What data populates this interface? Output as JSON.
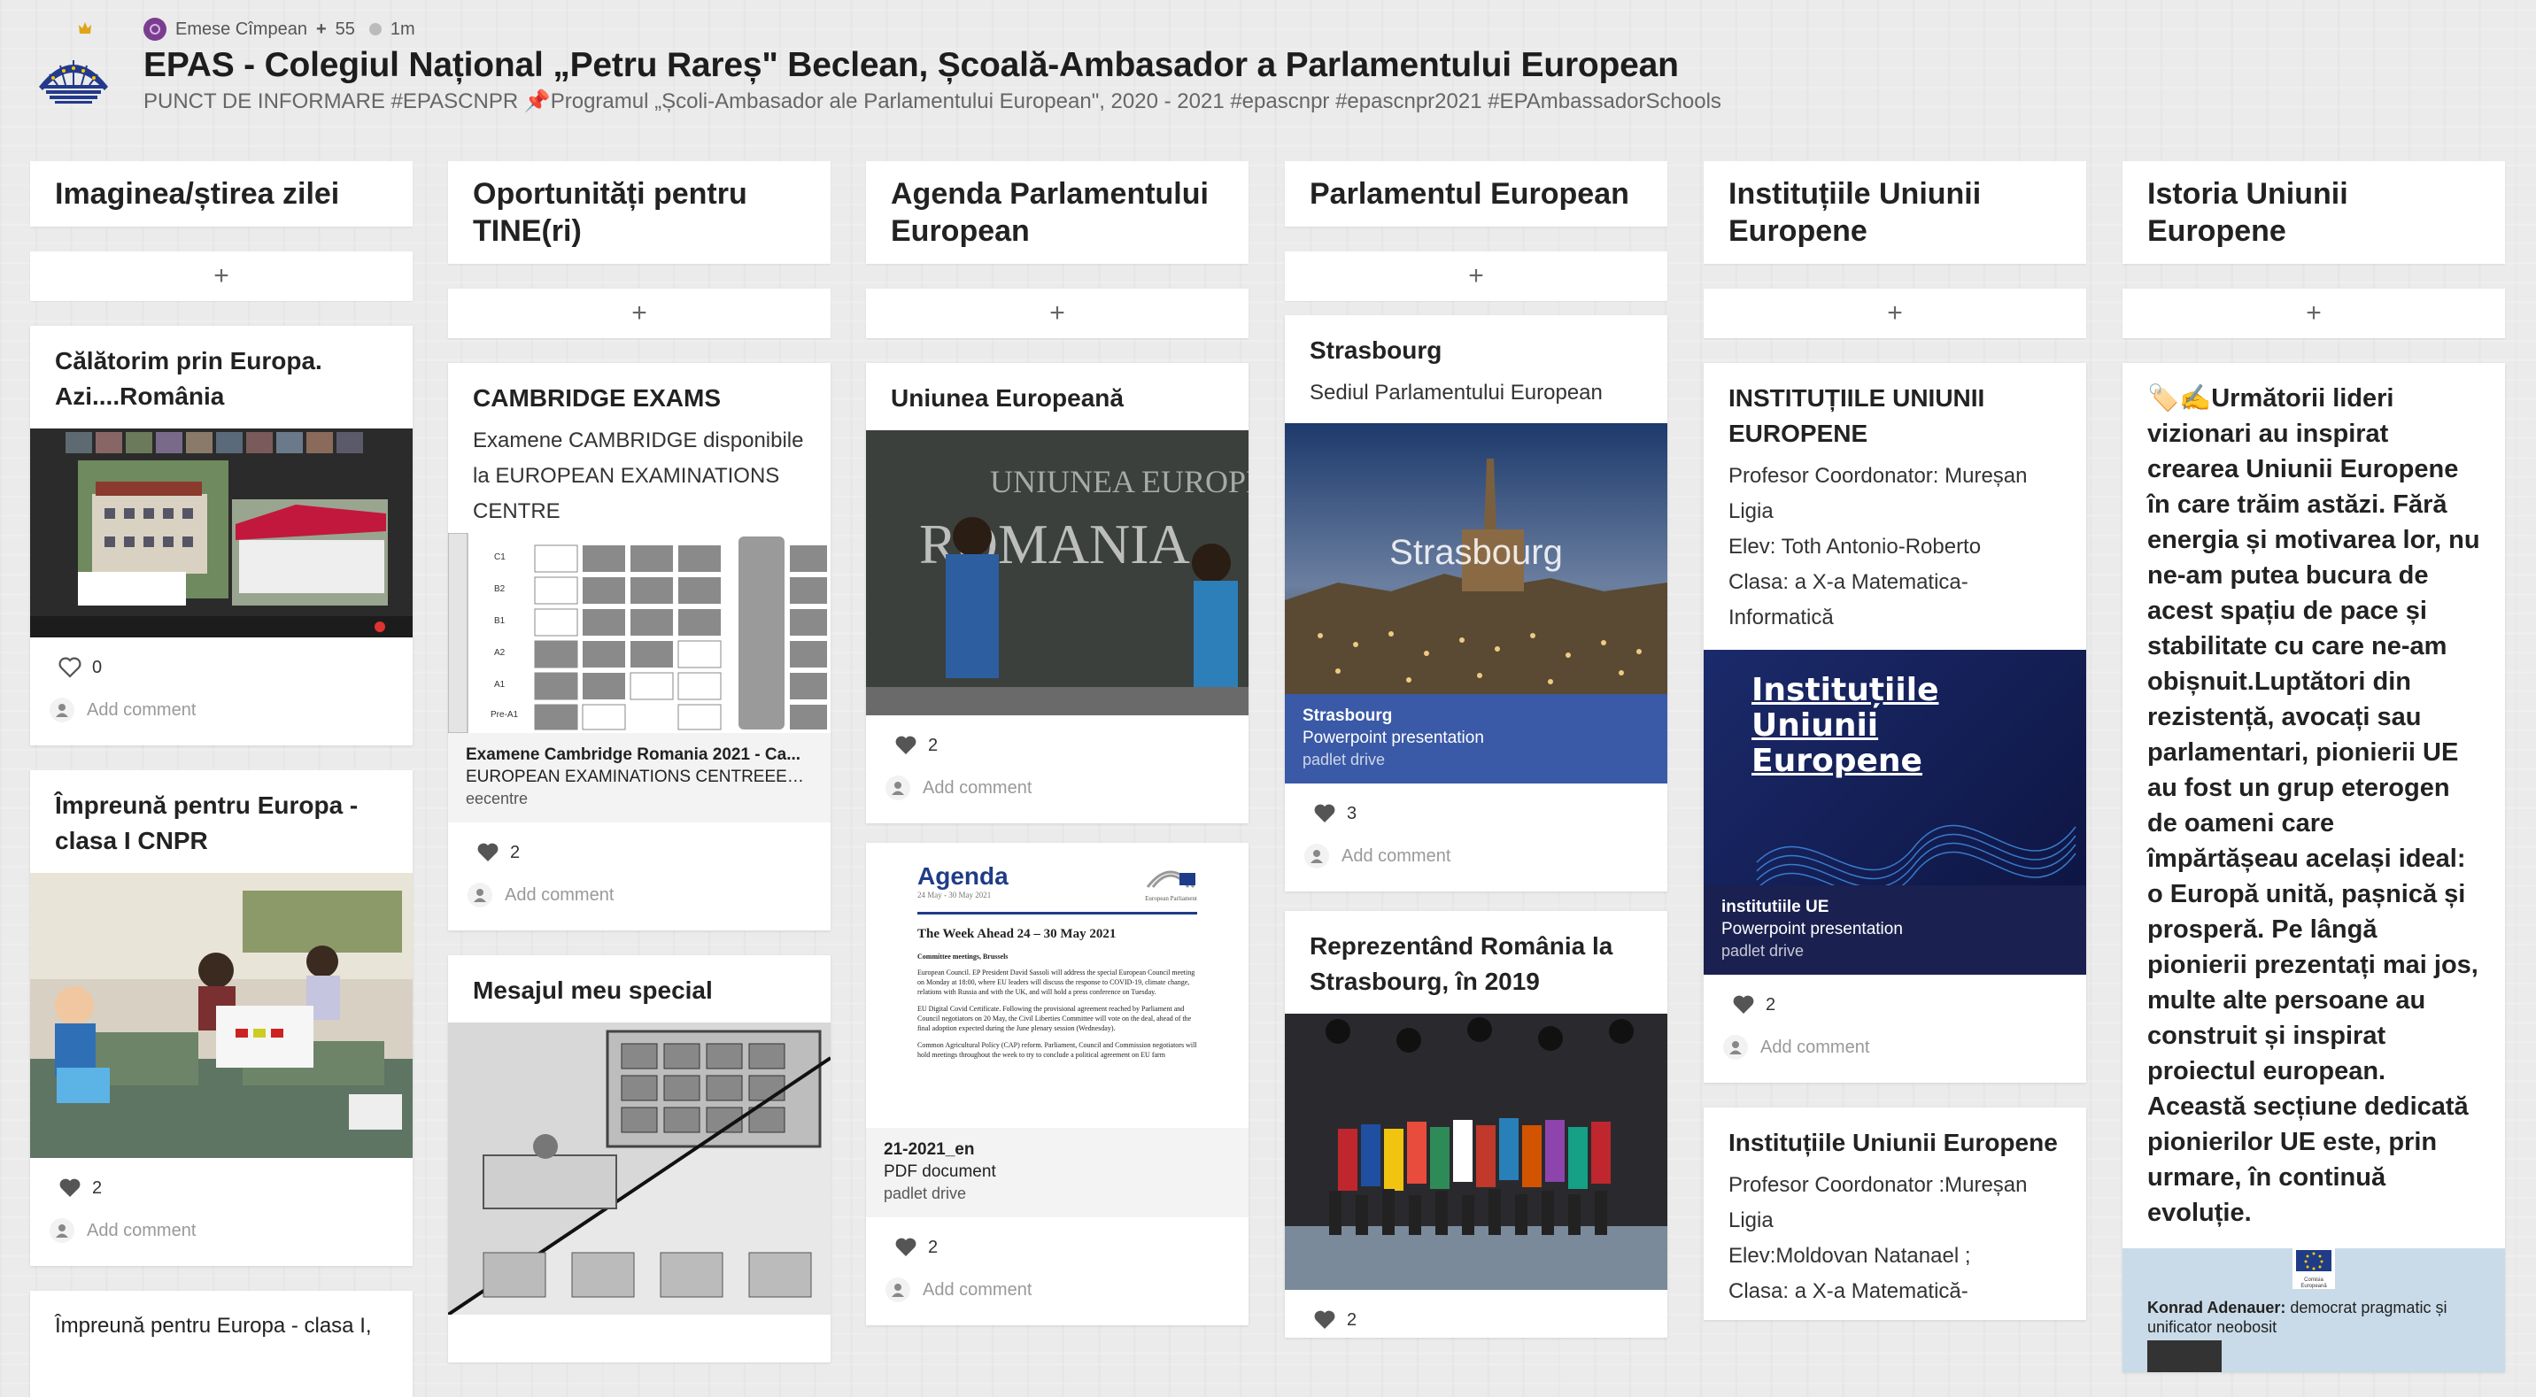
{
  "header": {
    "author": "Emese Cîmpean",
    "plus_count": "55",
    "time_ago": "1m",
    "title": "EPAS - Colegiul Național „Petru Rareș\" Beclean, Școală-Ambasador a Parlamentului European",
    "subtitle": "PUNCT DE INFORMARE #EPASCNPR 📌Programul „Școli-Ambasador ale Parlamentului European\", 2020 - 2021 #epascnpr #epascnpr2021 #EPAmbassadorSchools"
  },
  "common": {
    "add": "+",
    "add_comment": "Add comment"
  },
  "columns": [
    {
      "title": "Imaginea/știrea zilei",
      "cards": [
        {
          "title": "Călătorim prin Europa. Azi....România",
          "likes": "0"
        },
        {
          "title": "Împreună pentru Europa - clasa I CNPR",
          "likes": "2"
        },
        {
          "title": "Împreună pentru Europa - clasa I,"
        }
      ]
    },
    {
      "title": "Oportunități pentru TINE(ri)",
      "cards": [
        {
          "title": "CAMBRIDGE EXAMS",
          "body": "Examene CAMBRIDGE disponibile la EUROPEAN EXAMINATIONS CENTRE",
          "att_title": "Examene Cambridge Romania 2021 - Ca...",
          "att_sub": "EUROPEAN EXAMINATIONS CENTREEEC...",
          "att_src": "eecentre",
          "likes": "2"
        },
        {
          "title": "Mesajul meu special"
        }
      ]
    },
    {
      "title": "Agenda Parlamentului European",
      "cards": [
        {
          "title": "Uniunea Europeană",
          "likes": "2"
        },
        {
          "att_title": "21-2021_en",
          "att_sub": "PDF document",
          "att_src": "padlet drive",
          "likes": "2"
        }
      ],
      "agenda_doc": {
        "heading": "Agenda",
        "dates": "24 May - 30 May 2021",
        "ep": "European Parliament",
        "week": "The Week Ahead 24 – 30 May 2021",
        "section": "Committee meetings, Brussels",
        "p1": "European Council. EP President David Sassoli will address the special European Council meeting on Monday at 18:00, where EU leaders will discuss the response to COVID-19, climate change, relations with Russia and with the UK, and will hold a press conference on Tuesday.",
        "p2": "EU Digital Covid Certificate. Following the provisional agreement reached by Parliament and Council negotiators on 20 May, the Civil Liberties Committee will vote on the deal, ahead of the final adoption expected during the June plenary session (Wednesday).",
        "p3": "Common Agricultural Policy (CAP) reform. Parliament, Council and Commission negotiators will hold meetings throughout the week to try to conclude a political agreement on EU farm"
      }
    },
    {
      "title": "Parlamentul European",
      "cards": [
        {
          "title": "Strasbourg",
          "body": "Sediul Parlamentului European",
          "img_label": "Strasbourg",
          "att_title": "Strasbourg",
          "att_sub": "Powerpoint presentation",
          "att_src": "padlet drive",
          "likes": "3"
        },
        {
          "title": "Reprezentând România la Strasbourg, în 2019",
          "likes": "2"
        }
      ]
    },
    {
      "title": "Instituțiile Uniunii Europene",
      "cards": [
        {
          "title": "INSTITUȚIILE UNIUNII EUROPENE",
          "body": "Profesor Coordonator: Mureșan Ligia\nElev: Toth Antonio-Roberto\nClasa: a X-a Matematica-Informatică",
          "slide_title": "Instituțiile Uniunii Europene",
          "att_title": "institutiile UE",
          "att_sub": "Powerpoint presentation",
          "att_src": "padlet drive",
          "likes": "2"
        },
        {
          "title": "Instituțiile Uniunii Europene",
          "body": "Profesor Coordonator :Mureșan Ligia\nElev:Moldovan Natanael ;\nClasa: a X-a Matematică-"
        }
      ]
    },
    {
      "title": "Istoria Uniunii Europene",
      "cards": [
        {
          "body": "🏷️✍️Următorii lideri vizionari au inspirat crearea Uniunii Europene în care trăim astăzi. Fără energia și motivarea lor, nu ne-am putea bucura de acest spațiu de pace și stabilitate cu care ne-am obișnuit.Luptători din rezistență, avocați sau parlamentari, pionierii UE au fost un grup eterogen de oameni care împărtășeau același ideal: o Europă unită, pașnică și prosperă. Pe lângă pionierii prezentați mai jos, multe alte persoane au construit și inspirat proiectul european. Această secțiune dedicată pionierilor UE este, prin urmare, în continuă evoluție.",
          "doc_name": "Konrad Adenauer:",
          "doc_desc": "democrat pragmatic și unificator neobosit",
          "doc_logo": "Comisia Europeană"
        }
      ]
    }
  ],
  "icons": {
    "heart": "heart-outline-icon",
    "comment": "comment-avatar-icon",
    "add": "plus-icon"
  },
  "colors": {
    "strasbourg_att": "#3a5aa7",
    "institutii_att": "#1a2150",
    "avatar": "#7a3d8f"
  }
}
